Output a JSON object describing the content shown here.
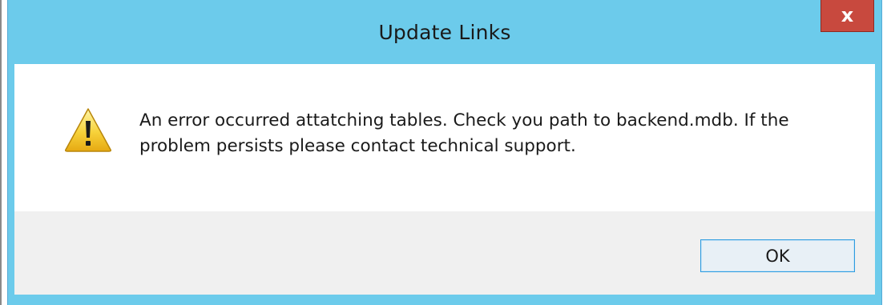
{
  "window": {
    "title": "Update Links",
    "close_label": "x"
  },
  "dialog": {
    "icon": "warning-icon",
    "message": "An error occurred attatching tables. Check you path to backend.mdb. If the problem persists please contact technical support.",
    "ok_label": "OK"
  },
  "colors": {
    "titlebar": "#6ccbeb",
    "close_button": "#c8493e",
    "footer": "#f0f0f0",
    "button_border": "#2e9ce0"
  }
}
